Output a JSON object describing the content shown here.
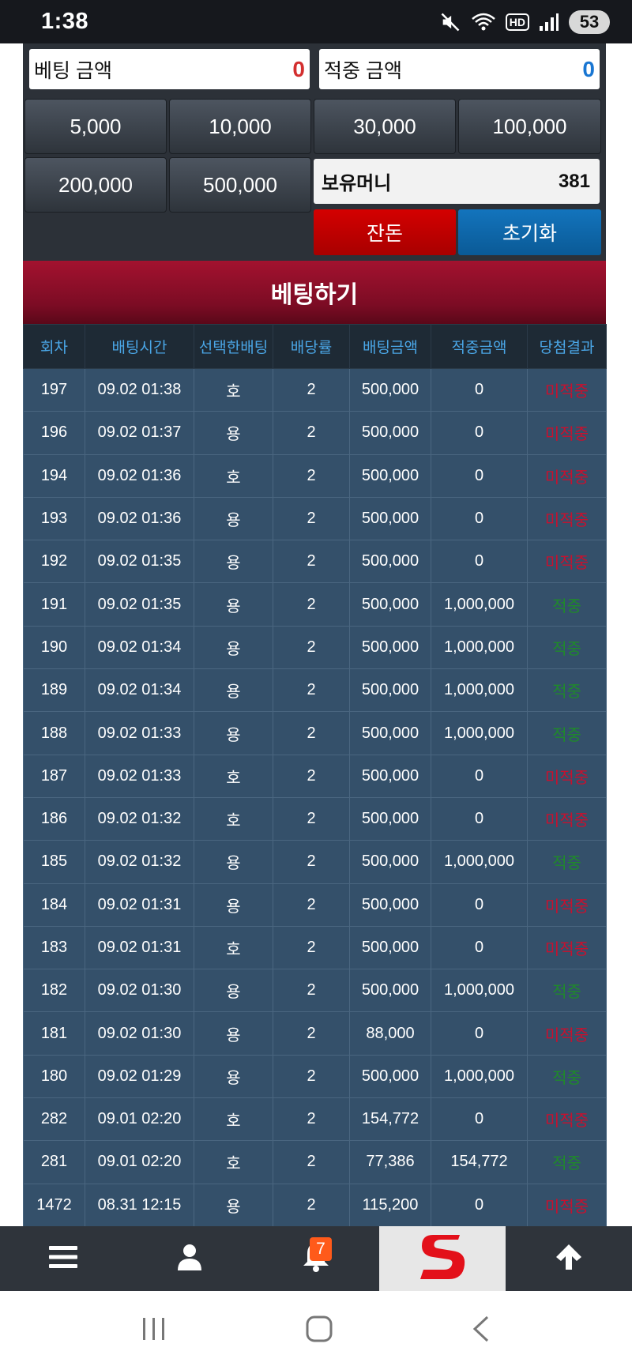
{
  "status_bar": {
    "time": "1:38",
    "hd": "HD",
    "battery": "53"
  },
  "amounts": {
    "bet_label": "베팅 금액",
    "bet_value": "0",
    "win_label": "적중 금액",
    "win_value": "0"
  },
  "chips": [
    "5,000",
    "10,000",
    "30,000",
    "100,000",
    "200,000",
    "500,000"
  ],
  "holding": {
    "label": "보유머니",
    "value": "381"
  },
  "actions": {
    "balance": "잔돈",
    "reset": "초기화"
  },
  "bet_button": "베팅하기",
  "table": {
    "headers": [
      "회차",
      "배팅시간",
      "선택한배팅",
      "배당률",
      "배팅금액",
      "적중금액",
      "당첨결과"
    ],
    "rows": [
      {
        "round": "197",
        "time": "09.02 01:38",
        "pick": "호",
        "odds": "2",
        "bet": "500,000",
        "payout": "0",
        "result": "미적중",
        "win": false
      },
      {
        "round": "196",
        "time": "09.02 01:37",
        "pick": "용",
        "odds": "2",
        "bet": "500,000",
        "payout": "0",
        "result": "미적중",
        "win": false
      },
      {
        "round": "194",
        "time": "09.02 01:36",
        "pick": "호",
        "odds": "2",
        "bet": "500,000",
        "payout": "0",
        "result": "미적중",
        "win": false
      },
      {
        "round": "193",
        "time": "09.02 01:36",
        "pick": "용",
        "odds": "2",
        "bet": "500,000",
        "payout": "0",
        "result": "미적중",
        "win": false
      },
      {
        "round": "192",
        "time": "09.02 01:35",
        "pick": "용",
        "odds": "2",
        "bet": "500,000",
        "payout": "0",
        "result": "미적중",
        "win": false
      },
      {
        "round": "191",
        "time": "09.02 01:35",
        "pick": "용",
        "odds": "2",
        "bet": "500,000",
        "payout": "1,000,000",
        "result": "적중",
        "win": true
      },
      {
        "round": "190",
        "time": "09.02 01:34",
        "pick": "용",
        "odds": "2",
        "bet": "500,000",
        "payout": "1,000,000",
        "result": "적중",
        "win": true
      },
      {
        "round": "189",
        "time": "09.02 01:34",
        "pick": "용",
        "odds": "2",
        "bet": "500,000",
        "payout": "1,000,000",
        "result": "적중",
        "win": true
      },
      {
        "round": "188",
        "time": "09.02 01:33",
        "pick": "용",
        "odds": "2",
        "bet": "500,000",
        "payout": "1,000,000",
        "result": "적중",
        "win": true
      },
      {
        "round": "187",
        "time": "09.02 01:33",
        "pick": "호",
        "odds": "2",
        "bet": "500,000",
        "payout": "0",
        "result": "미적중",
        "win": false
      },
      {
        "round": "186",
        "time": "09.02 01:32",
        "pick": "호",
        "odds": "2",
        "bet": "500,000",
        "payout": "0",
        "result": "미적중",
        "win": false
      },
      {
        "round": "185",
        "time": "09.02 01:32",
        "pick": "용",
        "odds": "2",
        "bet": "500,000",
        "payout": "1,000,000",
        "result": "적중",
        "win": true
      },
      {
        "round": "184",
        "time": "09.02 01:31",
        "pick": "용",
        "odds": "2",
        "bet": "500,000",
        "payout": "0",
        "result": "미적중",
        "win": false
      },
      {
        "round": "183",
        "time": "09.02 01:31",
        "pick": "호",
        "odds": "2",
        "bet": "500,000",
        "payout": "0",
        "result": "미적중",
        "win": false
      },
      {
        "round": "182",
        "time": "09.02 01:30",
        "pick": "용",
        "odds": "2",
        "bet": "500,000",
        "payout": "1,000,000",
        "result": "적중",
        "win": true
      },
      {
        "round": "181",
        "time": "09.02 01:30",
        "pick": "용",
        "odds": "2",
        "bet": "88,000",
        "payout": "0",
        "result": "미적중",
        "win": false
      },
      {
        "round": "180",
        "time": "09.02 01:29",
        "pick": "용",
        "odds": "2",
        "bet": "500,000",
        "payout": "1,000,000",
        "result": "적중",
        "win": true
      },
      {
        "round": "282",
        "time": "09.01 02:20",
        "pick": "호",
        "odds": "2",
        "bet": "154,772",
        "payout": "0",
        "result": "미적중",
        "win": false
      },
      {
        "round": "281",
        "time": "09.01 02:20",
        "pick": "호",
        "odds": "2",
        "bet": "77,386",
        "payout": "154,772",
        "result": "적중",
        "win": true
      },
      {
        "round": "1472",
        "time": "08.31 12:15",
        "pick": "용",
        "odds": "2",
        "bet": "115,200",
        "payout": "0",
        "result": "미적중",
        "win": false
      }
    ]
  },
  "bottom_nav": {
    "items": [
      "menu-icon",
      "user-icon",
      "bell-icon",
      "brand-logo",
      "arrow-up-icon"
    ],
    "notification_count": "7"
  },
  "colors": {
    "bet_value": "#d32f2f",
    "win_value": "#1976d2",
    "balance_button": "#c00000",
    "reset_button": "#0b67a8",
    "result_lose": "#c8102e",
    "result_win": "#1f8a2a"
  }
}
